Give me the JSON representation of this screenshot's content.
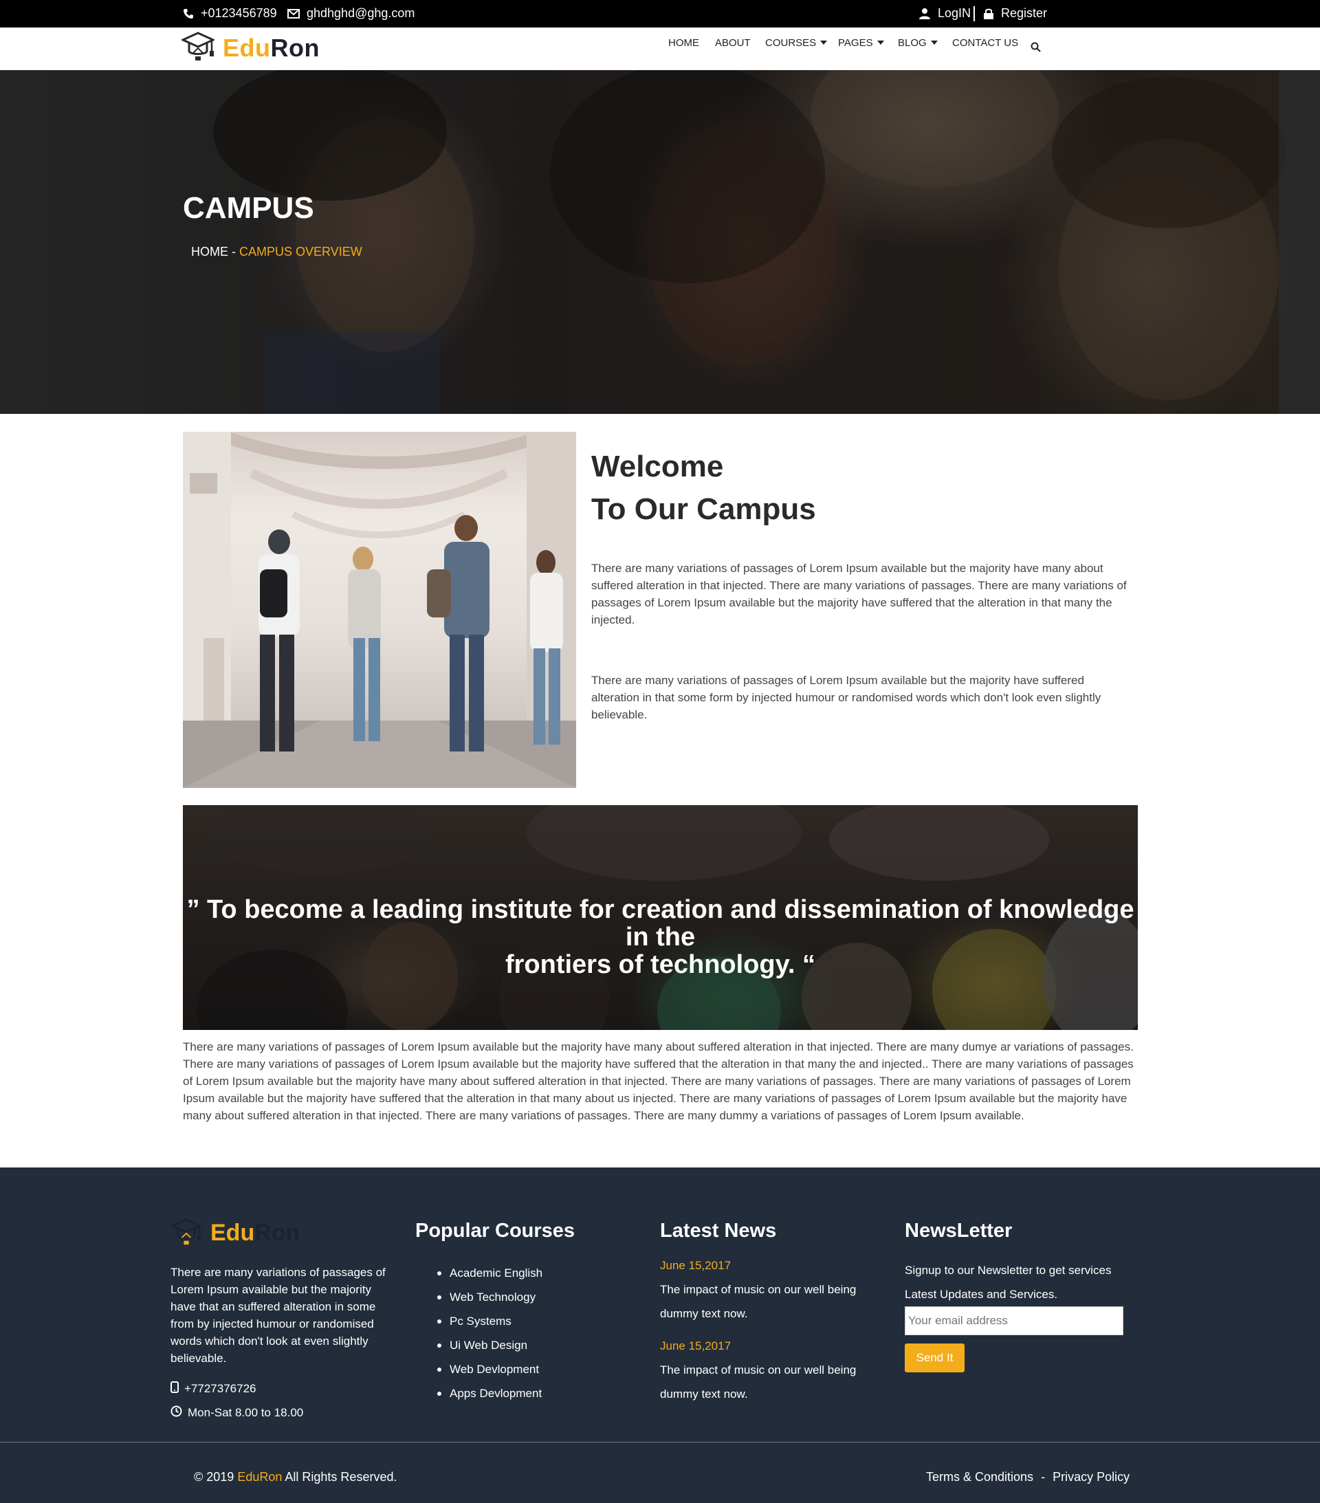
{
  "topbar": {
    "phone": "+0123456789",
    "email": "ghdhghd@ghg.com",
    "login": "LogIN",
    "register": "Register"
  },
  "brand": {
    "first": "Edu",
    "second": "Ron"
  },
  "nav": {
    "home": "HOME",
    "about": "ABOUT",
    "courses": "COURSES",
    "pages": "PAGES",
    "blog": "BLOG",
    "contact": "CONTACT US"
  },
  "hero": {
    "title": "CAMPUS",
    "crumb_home": "HOME",
    "crumb_sep": " - ",
    "crumb_current": "CAMPUS OVERVIEW"
  },
  "welcome": {
    "line1": "Welcome",
    "line2": "To Our Campus",
    "p1": "There are many variations of passages of Lorem Ipsum available but the majority have many about suffered alteration in that injected. There are many variations of passages. There are many variations of passages of Lorem Ipsum available but the majority have suffered that the alteration in that many the injected.",
    "p2": "There are many variations of passages of Lorem Ipsum available but the majority have suffered alteration in that some form by injected humour or randomised words which don't look even slightly believable."
  },
  "quote": {
    "line1": "” To become a leading institute for creation and dissemination of knowledge in the",
    "line2": "frontiers of technology. “"
  },
  "long_paragraph": "There are many variations of passages of Lorem Ipsum available but the majority have many about suffered alteration in that injected. There are many dumye ar variations of passages. There are many variations of passages of Lorem Ipsum available but the majority have suffered that the alteration in that many the and injected.. There are many variations of passages of Lorem Ipsum available but the majority have many about suffered alteration in that injected. There are many variations of passages. There are many variations of passages of Lorem Ipsum available but the majority have suffered that the alteration in that many about us injected. There are many variations of passages of Lorem Ipsum available but the majority have many about suffered alteration in that injected. There are many variations of passages. There are many dummy a variations of passages of Lorem Ipsum available.",
  "footer": {
    "about": "There are many variations of passages of Lorem Ipsum available but the majority have that an suffered alteration in some from by injected humour or randomised words which don't look at even slightly believable.",
    "phone": "+7727376726",
    "hours": "Mon-Sat 8.00 to 18.00",
    "courses_heading": "Popular Courses",
    "courses": [
      "Academic English",
      "Web Technology",
      "Pc Systems",
      "Ui Web Design",
      "Web Devlopment",
      "Apps Devlopment"
    ],
    "news_heading": "Latest News",
    "news": [
      {
        "date": "June 15,2017",
        "line1": "The impact of music on our well being",
        "line2": "dummy text now."
      },
      {
        "date": "June 15,2017",
        "line1": "The impact of music on our well being",
        "line2": "dummy text now."
      }
    ],
    "newsletter_heading": "NewsLetter",
    "newsletter_text": "Signup to our Newsletter to get services Latest Updates and Services.",
    "email_placeholder": "Your email address",
    "send_label": "Send It",
    "copyright_prefix": "© 2019",
    "copyright_brand": "EduRon",
    "copyright_suffix": "All Rights Reserved.",
    "terms": "Terms & Conditions",
    "links_sep": "-",
    "privacy": "Privacy Policy"
  },
  "colors": {
    "accent": "#f3ad1b",
    "footer_bg": "#222c3b",
    "topbar_bg": "#000000"
  },
  "icons": [
    "phone-icon",
    "envelope-icon",
    "user-icon",
    "lock-icon",
    "graduation-cap-icon",
    "search-icon",
    "caret-down-icon",
    "mobile-icon",
    "clock-icon"
  ]
}
